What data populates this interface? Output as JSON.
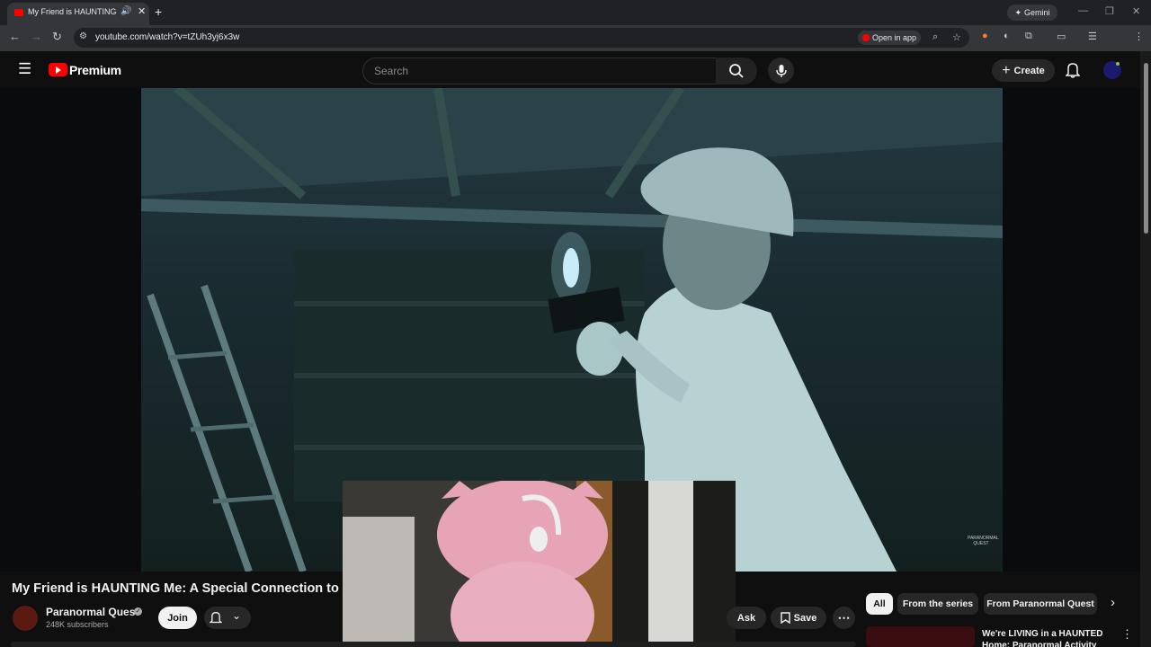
{
  "browser": {
    "tab_title": "My Friend is HAUNTING Me: A Special Connection",
    "new_tab": "+",
    "gemini_label": "Gemini",
    "url": "youtube.com/watch?v=tZUh3yj6x3w",
    "open_in_app": "Open in app"
  },
  "masthead": {
    "logo_text": "Premium",
    "search_placeholder": "Search",
    "create_label": "Create"
  },
  "video": {
    "title": "My Friend is HAUNTING Me: A Special Connection to a G",
    "watermark": "PARANORMAL QUEST"
  },
  "channel": {
    "name": "Paranormal Quest",
    "subscribers": "248K subscribers",
    "join_label": "Join"
  },
  "actions": {
    "ask_label": "Ask",
    "save_label": "Save"
  },
  "chips": [
    "All",
    "From the series",
    "From Paranormal Quest"
  ],
  "recommendation": {
    "title": "We're LIVING in a HAUNTED Home: Paranormal Activity"
  },
  "colors": {
    "brand_red": "#ff0000",
    "background": "#0f0f0f",
    "night_vision": "#243a40"
  }
}
